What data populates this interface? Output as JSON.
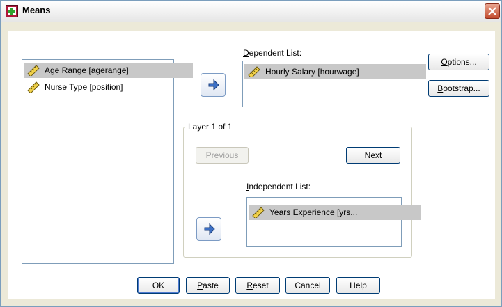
{
  "window": {
    "title": "Means"
  },
  "source_list": {
    "items": [
      {
        "label": "Age Range [agerange]",
        "icon": "scale-ruler-icon",
        "selected": true
      },
      {
        "label": "Nurse Type [position]",
        "icon": "scale-ruler-icon",
        "selected": false
      }
    ]
  },
  "dependent": {
    "label_pre": "",
    "label_underlined": "D",
    "label_post": "ependent List:",
    "items": [
      {
        "label": "Hourly Salary [hourwage]",
        "icon": "scale-ruler-icon"
      }
    ]
  },
  "layer": {
    "legend": "Layer 1 of 1",
    "previous": {
      "pre": "Pre",
      "u": "v",
      "post": "ious",
      "enabled": false
    },
    "next": {
      "pre": "",
      "u": "N",
      "post": "ext",
      "enabled": true
    }
  },
  "independent": {
    "label_pre": "",
    "label_underlined": "I",
    "label_post": "ndependent List:",
    "items": [
      {
        "label": "Years Experience [yrs...",
        "icon": "scale-ruler-icon"
      }
    ]
  },
  "side_buttons": {
    "options": {
      "pre": "",
      "u": "O",
      "post": "ptions..."
    },
    "bootstrap": {
      "pre": "",
      "u": "B",
      "post": "ootstrap..."
    }
  },
  "bottom_buttons": {
    "ok": {
      "pre": "OK",
      "u": "",
      "post": ""
    },
    "paste": {
      "pre": "",
      "u": "P",
      "post": "aste"
    },
    "reset": {
      "pre": "",
      "u": "R",
      "post": "eset"
    },
    "cancel": {
      "pre": "Cancel",
      "u": "",
      "post": ""
    },
    "help": {
      "pre": "Help",
      "u": "",
      "post": ""
    }
  },
  "colors": {
    "accent": "#3c6fc4",
    "selection": "#c8c8c8"
  }
}
